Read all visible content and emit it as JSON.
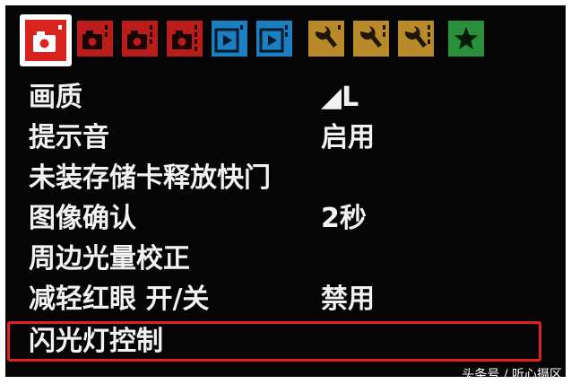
{
  "tabs": [
    {
      "icon": "camera-shooting-icon",
      "color": "#d8231f",
      "active": true
    },
    {
      "icon": "camera-shooting-icon",
      "color": "#b81d1a",
      "active": false
    },
    {
      "icon": "camera-shooting-icon",
      "color": "#b81d1a",
      "active": false
    },
    {
      "icon": "camera-shooting-icon",
      "color": "#b81d1a",
      "active": false
    },
    {
      "icon": "playback-icon",
      "color": "#1b7fc1",
      "active": false
    },
    {
      "icon": "playback-icon",
      "color": "#1b7fc1",
      "active": false
    },
    {
      "icon": "wrench-setup-icon",
      "color": "#b88a2a",
      "active": false
    },
    {
      "icon": "wrench-setup-icon",
      "color": "#b88a2a",
      "active": false
    },
    {
      "icon": "wrench-setup-icon",
      "color": "#b88a2a",
      "active": false
    },
    {
      "icon": "star-my-menu-icon",
      "color": "#2a8f3b",
      "active": false
    }
  ],
  "menu": {
    "items": [
      {
        "label": "画质",
        "value": "◢L"
      },
      {
        "label": "提示音",
        "value": "启用"
      },
      {
        "label": "未装存储卡释放快门",
        "value": ""
      },
      {
        "label": "图像确认",
        "value": "2秒"
      },
      {
        "label": "周边光量校正",
        "value": ""
      },
      {
        "label": "减轻红眼 开/关",
        "value": "禁用"
      },
      {
        "label": "闪光灯控制",
        "value": ""
      }
    ],
    "selected_index": 6
  },
  "colors": {
    "background": "#050505",
    "text": "#f2f2f2",
    "highlight": "#e0231e"
  },
  "watermark": "头条号 / 听心摄区"
}
